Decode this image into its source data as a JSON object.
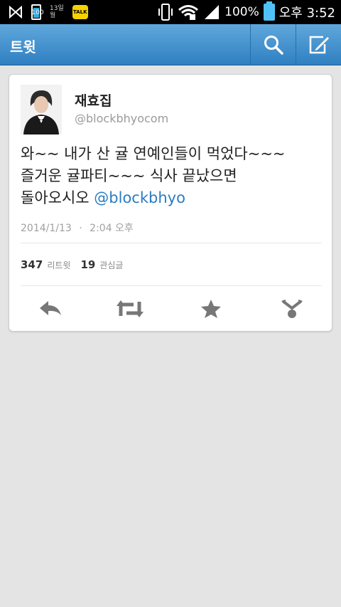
{
  "status_bar": {
    "battery_small_level": "100",
    "date_day": "13일",
    "date_month": "월",
    "talk_label": "TALK",
    "battery_percent": "100%",
    "time": "오후 3:52"
  },
  "appbar": {
    "title": "트윗"
  },
  "tweet": {
    "display_name": "재효집",
    "handle": "@blockbhyocom",
    "text_line1": "와~~ 내가 산 귤 연예인들이 먹었다~~~",
    "text_line2": "즐거운 귤파티~~~ 식사 끝났으면",
    "text_line3": "돌아오시오 ",
    "mention": "@blockbhyo",
    "date": "2014/1/13",
    "separator": "·",
    "time": "2:04 오후",
    "retweet_count": "347",
    "retweet_label": "리트윗",
    "fav_count": "19",
    "fav_label": "관심글"
  },
  "colors": {
    "appbar": "#3b8ccc",
    "mention": "#2a7cc2",
    "background": "#e4e4e4"
  }
}
